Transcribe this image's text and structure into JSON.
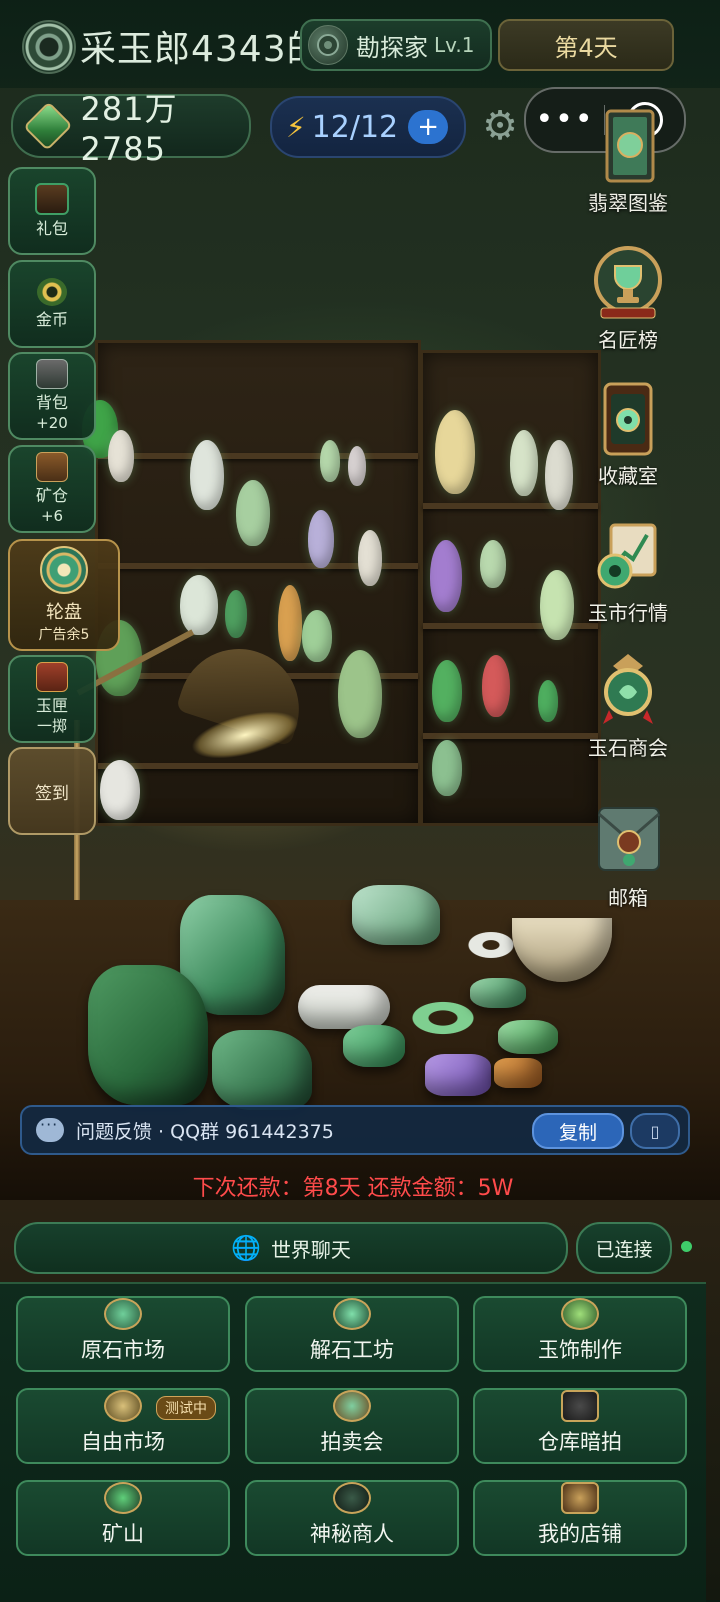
{
  "header": {
    "player_name": "采玉郎4343的",
    "title_badge": "勘探家",
    "title_level": "Lv.1",
    "day": "第4天"
  },
  "resources": {
    "coins": "281万2785",
    "energy": "12/12",
    "energy_plus": "+"
  },
  "capsule": {
    "more": "•••"
  },
  "left_menu": [
    {
      "label": "礼包",
      "sub": ""
    },
    {
      "label": "金币",
      "sub": ""
    },
    {
      "label": "背包",
      "sub": "+20"
    },
    {
      "label": "矿仓",
      "sub": "+6"
    }
  ],
  "wheel": {
    "label": "轮盘",
    "sub": "广告余5"
  },
  "toss": {
    "label": "玉匣",
    "sub": "一掷"
  },
  "signin": {
    "label": "签到"
  },
  "right_menu": [
    {
      "label": "翡翠图鉴",
      "icon": "book-icon"
    },
    {
      "label": "名匠榜",
      "icon": "trophy-icon"
    },
    {
      "label": "收藏室",
      "icon": "collection-cabinet-icon"
    },
    {
      "label": "玉市行情",
      "icon": "market-chart-icon"
    },
    {
      "label": "玉石商会",
      "icon": "chamber-icon"
    },
    {
      "label": "邮箱",
      "icon": "mail-icon"
    }
  ],
  "feedback": {
    "text": "问题反馈 · QQ群 961442375",
    "copy_label": "复制",
    "extra_label": "▯"
  },
  "repayment": "下次还款：第8天 还款金额：5W",
  "chat": {
    "world_label": "世界聊天",
    "status_label": "已连接",
    "status_color": "#3fcc6a"
  },
  "main_grid": [
    {
      "label": "原石市场",
      "badge": ""
    },
    {
      "label": "解石工坊",
      "badge": ""
    },
    {
      "label": "玉饰制作",
      "badge": ""
    },
    {
      "label": "自由市场",
      "badge": "测试中"
    },
    {
      "label": "拍卖会",
      "badge": ""
    },
    {
      "label": "仓库暗拍",
      "badge": ""
    },
    {
      "label": "矿山",
      "badge": ""
    },
    {
      "label": "神秘商人",
      "badge": ""
    },
    {
      "label": "我的店铺",
      "badge": ""
    }
  ],
  "colors": {
    "accent_green": "#3e8a5c",
    "alert_red": "#ff4b4b",
    "gold": "#c8a45a"
  }
}
